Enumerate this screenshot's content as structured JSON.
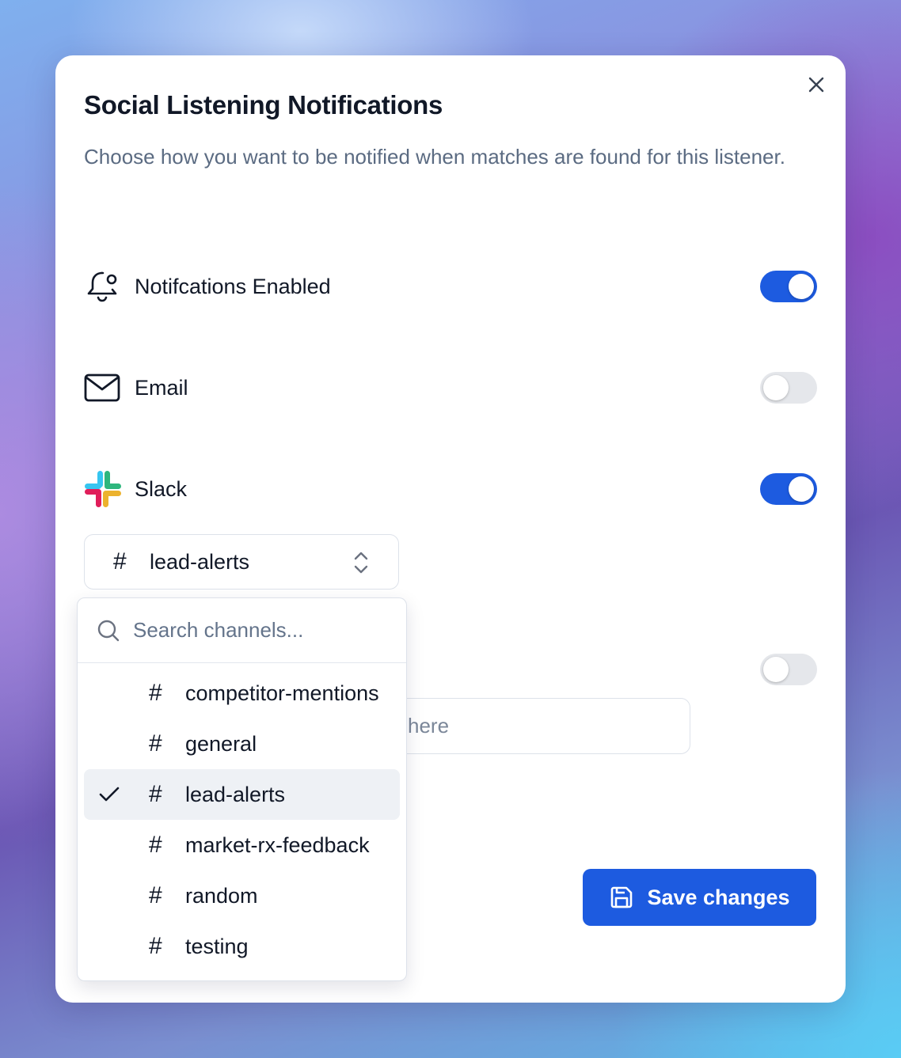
{
  "dialog": {
    "title": "Social Listening Notifications",
    "description": "Choose how you want to be notified when matches are found for this listener.",
    "close_icon": "close-icon"
  },
  "settings": [
    {
      "label": "Notifcations Enabled",
      "icon": "bell-icon",
      "enabled": true
    },
    {
      "label": "Email",
      "icon": "mail-icon",
      "enabled": false
    },
    {
      "label": "Slack",
      "icon": "slack-logo-icon",
      "enabled": true
    }
  ],
  "slack_channel_select": {
    "prefix": "#",
    "selected": "lead-alerts"
  },
  "channel_dropdown": {
    "search_placeholder": "Search channels...",
    "options": [
      {
        "prefix": "#",
        "name": "competitor-mentions",
        "selected": false
      },
      {
        "prefix": "#",
        "name": "general",
        "selected": false
      },
      {
        "prefix": "#",
        "name": "lead-alerts",
        "selected": true
      },
      {
        "prefix": "#",
        "name": "market-rx-feedback",
        "selected": false
      },
      {
        "prefix": "#",
        "name": "random",
        "selected": false
      },
      {
        "prefix": "#",
        "name": "testing",
        "selected": false
      }
    ]
  },
  "webhook": {
    "enabled": false,
    "visible_placeholder_fragment": "here"
  },
  "footer": {
    "save_label": "Save changes"
  },
  "colors": {
    "accent": "#1d5be0",
    "toggle_off": "#e5e7eb",
    "selected_row": "#eef1f5"
  }
}
